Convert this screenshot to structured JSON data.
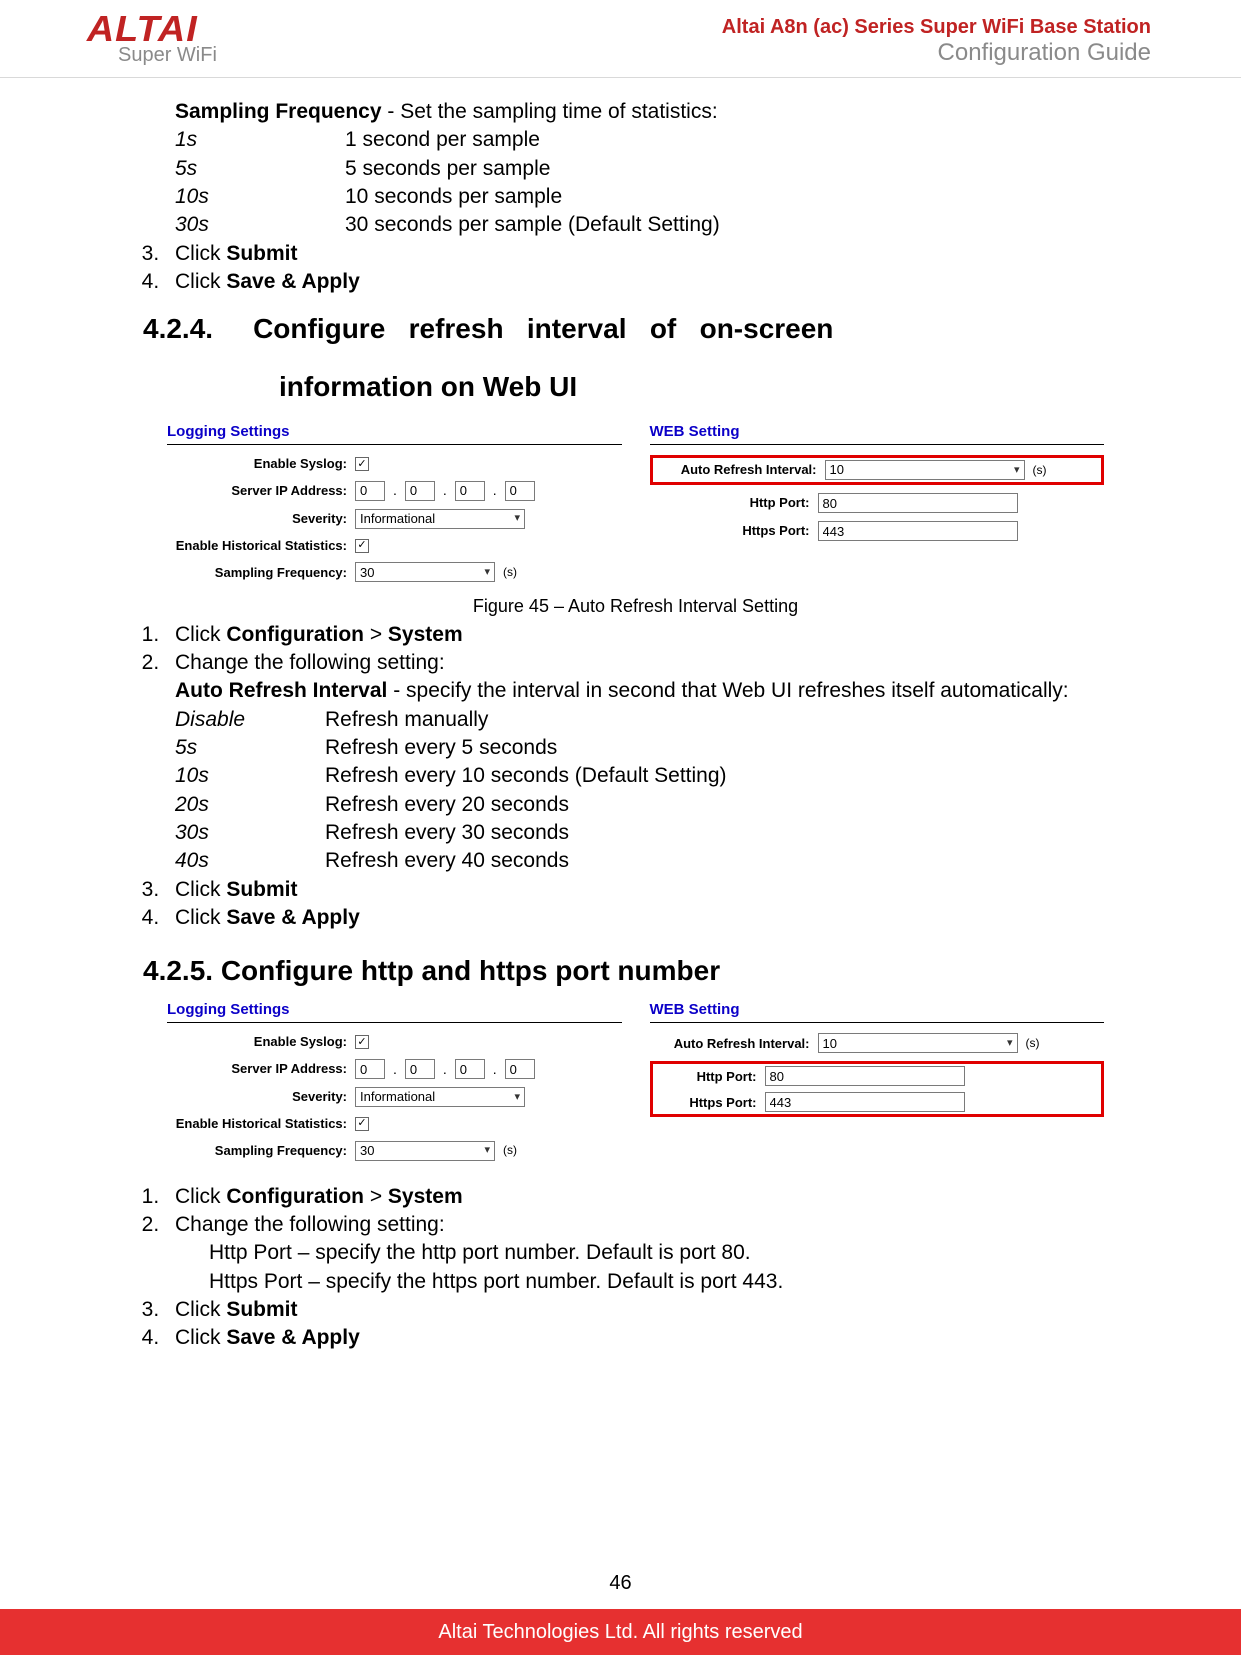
{
  "header": {
    "logo_main": "ALTAI",
    "logo_sub": "Super WiFi",
    "product_line": "Altai A8n (ac) Series Super WiFi Base Station",
    "guide_line": "Configuration Guide"
  },
  "sec1": {
    "lead_bold": "Sampling Frequency",
    "lead_rest": " - Set the sampling time of statistics:",
    "rows": [
      {
        "k": "1s",
        "v": "1 second per sample"
      },
      {
        "k": "5s",
        "v": "5 seconds per sample"
      },
      {
        "k": "10s",
        "v": "10 seconds per sample"
      },
      {
        "k": "30s",
        "v": "30 seconds per sample (Default Setting)"
      }
    ],
    "step3_pre": "Click ",
    "step3_bold": "Submit",
    "step4_pre": "Click ",
    "step4_bold": "Save & Apply"
  },
  "sec424": {
    "heading_prefix": "4.2.4.",
    "heading_line1": "Configure   refresh   interval   of   on-screen",
    "heading_line2": "information on Web UI",
    "caption": "Figure 45 – Auto Refresh Interval Setting",
    "step1_pre": "Click ",
    "step1_b1": "Configuration",
    "step1_gt": " > ",
    "step1_b2": "System",
    "step2": "Change the following setting:",
    "auto_bold": "Auto  Refresh  Interval",
    "auto_rest": " - specify the interval in second that Web UI refreshes itself automatically:",
    "opts": [
      {
        "k": "Disable",
        "v": "Refresh manually"
      },
      {
        "k": "5s",
        "v": "Refresh every 5 seconds"
      },
      {
        "k": "10s",
        "v": "Refresh every 10 seconds (Default Setting)"
      },
      {
        "k": "20s",
        "v": "Refresh every 20 seconds"
      },
      {
        "k": "30s",
        "v": "Refresh every 30 seconds"
      },
      {
        "k": "40s",
        "v": "Refresh every 40 seconds"
      }
    ],
    "step3_pre": "Click ",
    "step3_bold": "Submit",
    "step4_pre": "Click ",
    "step4_bold": "Save & Apply"
  },
  "sec425": {
    "heading": "4.2.5.     Configure http and https port number",
    "step1_pre": "Click ",
    "step1_b1": "Configuration",
    "step1_gt": " > ",
    "step1_b2": "System",
    "step2": "Change the following setting:",
    "sub1": "Http Port – specify the http port number. Default is port 80.",
    "sub2": "Https Port – specify the https port number. Default is port 443.",
    "step3_pre": "Click ",
    "step3_bold": "Submit",
    "step4_pre": "Click ",
    "step4_bold": "Save & Apply"
  },
  "ui": {
    "left_title": "Logging Settings",
    "right_title": "WEB Setting",
    "enable_syslog_lbl": "Enable Syslog:",
    "server_ip_lbl": "Server IP Address:",
    "severity_lbl": "Severity:",
    "severity_val": "Informational",
    "hist_lbl": "Enable Historical Statistics:",
    "sampling_lbl": "Sampling Frequency:",
    "sampling_val": "30",
    "auto_refresh_lbl": "Auto Refresh Interval:",
    "auto_refresh_val": "10",
    "http_port_lbl": "Http Port:",
    "http_port_val": "80",
    "https_port_lbl": "Https Port:",
    "https_port_val": "443",
    "unit_s": "(s)",
    "ip_parts": [
      "0",
      "0",
      "0",
      "0"
    ]
  },
  "footer": {
    "page_number": "46",
    "copyright": "Altai Technologies Ltd. All rights reserved"
  }
}
